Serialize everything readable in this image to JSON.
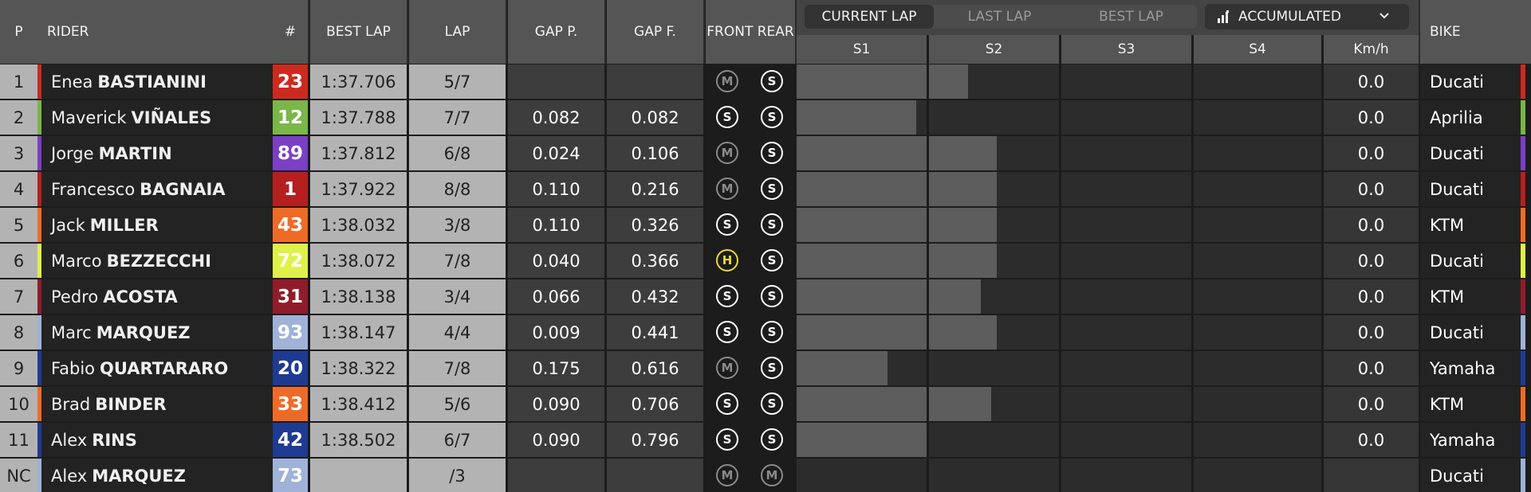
{
  "header": {
    "p": "P",
    "rider": "RIDER",
    "num": "#",
    "best_lap": "BEST LAP",
    "lap": "LAP",
    "gap_p": "GAP P.",
    "gap_f": "GAP F.",
    "front_rear": "FRONT REAR",
    "tabs": [
      "CURRENT LAP",
      "LAST LAP",
      "BEST LAP"
    ],
    "active_tab": "CURRENT LAP",
    "mode_select": "ACCUMULATED",
    "sectors": [
      "S1",
      "S2",
      "S3",
      "S4"
    ],
    "kmh": "Km/h",
    "bike": "BIKE"
  },
  "rows": [
    {
      "p": "1",
      "first": "Enea",
      "last": "BASTIANINI",
      "num": "23",
      "color": "#cc2a1f",
      "best": "1:37.706",
      "lap": "5/7",
      "gap_p": "",
      "gap_f": "",
      "front": "M",
      "rear": "S",
      "s1": 1.0,
      "s2": 0.3,
      "kmh": "0.0",
      "bike": "Ducati"
    },
    {
      "p": "2",
      "first": "Maverick",
      "last": "VIÑALES",
      "num": "12",
      "color": "#7ab648",
      "best": "1:37.788",
      "lap": "7/7",
      "gap_p": "0.082",
      "gap_f": "0.082",
      "front": "S",
      "rear": "S",
      "s1": 0.92,
      "s2": 0,
      "kmh": "0.0",
      "bike": "Aprilia"
    },
    {
      "p": "3",
      "first": "Jorge",
      "last": "MARTIN",
      "num": "89",
      "color": "#7b3fc4",
      "best": "1:37.812",
      "lap": "6/8",
      "gap_p": "0.024",
      "gap_f": "0.106",
      "front": "M",
      "rear": "S",
      "s1": 1.0,
      "s2": 0.52,
      "kmh": "0.0",
      "bike": "Ducati"
    },
    {
      "p": "4",
      "first": "Francesco",
      "last": "BAGNAIA",
      "num": "1",
      "color": "#b51f1f",
      "best": "1:37.922",
      "lap": "8/8",
      "gap_p": "0.110",
      "gap_f": "0.216",
      "front": "M",
      "rear": "S",
      "s1": 1.0,
      "s2": 0.52,
      "kmh": "0.0",
      "bike": "Ducati"
    },
    {
      "p": "5",
      "first": "Jack",
      "last": "MILLER",
      "num": "43",
      "color": "#ee6b27",
      "best": "1:38.032",
      "lap": "3/8",
      "gap_p": "0.110",
      "gap_f": "0.326",
      "front": "S",
      "rear": "S",
      "s1": 1.0,
      "s2": 0.52,
      "kmh": "0.0",
      "bike": "KTM"
    },
    {
      "p": "6",
      "first": "Marco",
      "last": "BEZZECCHI",
      "num": "72",
      "color": "#dff148",
      "best": "1:38.072",
      "lap": "7/8",
      "gap_p": "0.040",
      "gap_f": "0.366",
      "front": "H",
      "rear": "S",
      "s1": 1.0,
      "s2": 0.52,
      "kmh": "0.0",
      "bike": "Ducati"
    },
    {
      "p": "7",
      "first": "Pedro",
      "last": "ACOSTA",
      "num": "31",
      "color": "#8f1c2a",
      "best": "1:38.138",
      "lap": "3/4",
      "gap_p": "0.066",
      "gap_f": "0.432",
      "front": "S",
      "rear": "S",
      "s1": 1.0,
      "s2": 0.4,
      "kmh": "0.0",
      "bike": "KTM"
    },
    {
      "p": "8",
      "first": "Marc",
      "last": "MARQUEZ",
      "num": "93",
      "color": "#9fb2d8",
      "best": "1:38.147",
      "lap": "4/4",
      "gap_p": "0.009",
      "gap_f": "0.441",
      "front": "S",
      "rear": "S",
      "s1": 1.0,
      "s2": 0.52,
      "kmh": "0.0",
      "bike": "Ducati"
    },
    {
      "p": "9",
      "first": "Fabio",
      "last": "QUARTARARO",
      "num": "20",
      "color": "#1f3a92",
      "best": "1:38.322",
      "lap": "7/8",
      "gap_p": "0.175",
      "gap_f": "0.616",
      "front": "M",
      "rear": "S",
      "s1": 0.7,
      "s2": 0,
      "kmh": "0.0",
      "bike": "Yamaha"
    },
    {
      "p": "10",
      "first": "Brad",
      "last": "BINDER",
      "num": "33",
      "color": "#ee6b27",
      "best": "1:38.412",
      "lap": "5/6",
      "gap_p": "0.090",
      "gap_f": "0.706",
      "front": "S",
      "rear": "S",
      "s1": 1.0,
      "s2": 0.48,
      "kmh": "0.0",
      "bike": "KTM"
    },
    {
      "p": "11",
      "first": "Alex",
      "last": "RINS",
      "num": "42",
      "color": "#1f3a92",
      "best": "1:38.502",
      "lap": "6/7",
      "gap_p": "0.090",
      "gap_f": "0.796",
      "front": "S",
      "rear": "S",
      "s1": 1.0,
      "s2": 0,
      "kmh": "0.0",
      "bike": "Yamaha"
    },
    {
      "p": "NC",
      "first": "Alex",
      "last": "MARQUEZ",
      "num": "73",
      "color": "#9fb2d8",
      "best": "",
      "lap": "/3",
      "gap_p": "",
      "gap_f": "",
      "front": "M",
      "rear": "M",
      "s1": 0,
      "s2": 0,
      "kmh": "",
      "bike": "Ducati"
    }
  ]
}
